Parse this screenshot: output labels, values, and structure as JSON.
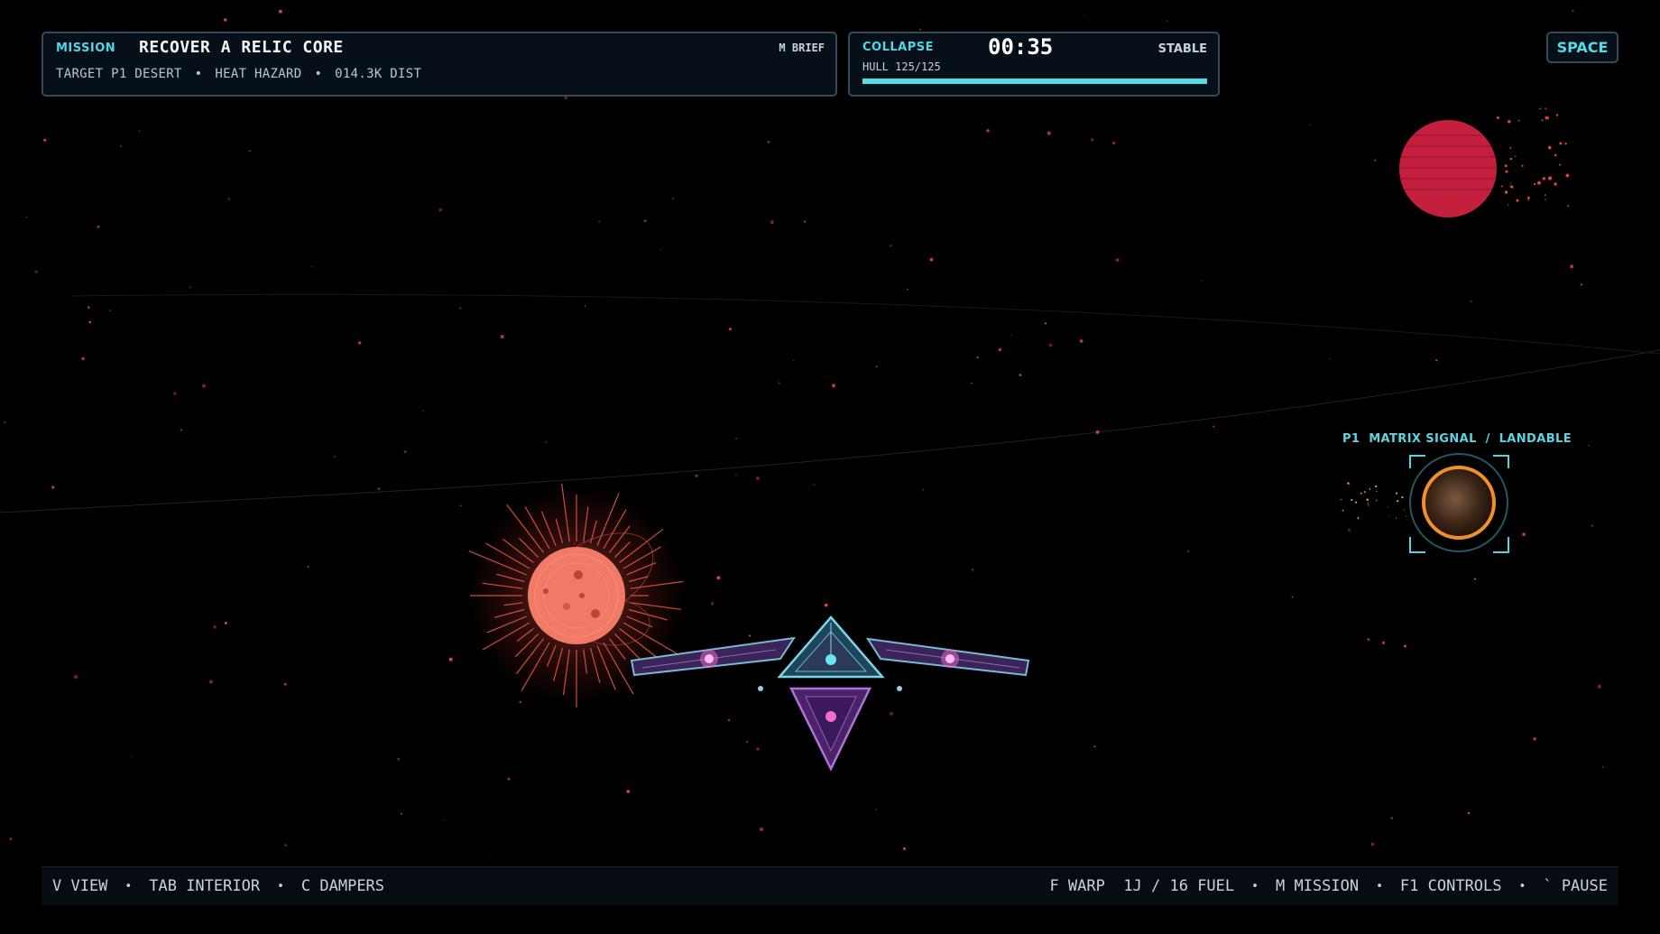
{
  "mission": {
    "tag": "MISSION",
    "title": "RECOVER A RELIC CORE",
    "brief_key": "M BRIEF",
    "details": [
      "TARGET P1 DESERT",
      "HEAT HAZARD",
      "014.3K DIST"
    ],
    "separator": "•"
  },
  "collapse": {
    "tag": "COLLAPSE",
    "timer": "00:35",
    "status": "STABLE",
    "hull_label": "HULL 125/125",
    "hull_fraction": 1.0
  },
  "view_mode_button": "SPACE",
  "target": {
    "label": "P1  MATRIX SIGNAL  /  LANDABLE"
  },
  "controls_left": [
    {
      "label": "V VIEW"
    },
    {
      "label": "TAB INTERIOR"
    },
    {
      "label": "C DAMPERS"
    }
  ],
  "controls_right": [
    {
      "label": "F WARP  1J / 16 FUEL"
    },
    {
      "label": "M MISSION"
    },
    {
      "label": "F1 CONTROLS"
    },
    {
      "label": "` PAUSE"
    }
  ],
  "colors": {
    "accent": "#4ed7e6",
    "panel_border": "#34495a",
    "star": "#f08070",
    "red_planet": "#c0203d",
    "target_planet_ring": "#f0902a",
    "ship_frame": "#6ec6e0",
    "ship_body": "#4a2a6a",
    "ship_glow": "#f06ac8"
  }
}
